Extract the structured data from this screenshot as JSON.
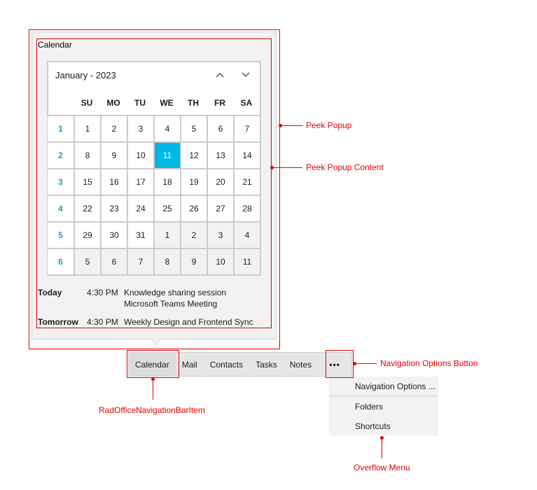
{
  "popup": {
    "title": "Calendar",
    "calendar": {
      "month_label": "January - 2023",
      "prev_icon": "chevron-up-icon",
      "next_icon": "chevron-down-icon",
      "prev_glyph": "⌃",
      "next_glyph": "⌄",
      "days_of_week": [
        "SU",
        "MO",
        "TU",
        "WE",
        "TH",
        "FR",
        "SA"
      ],
      "selected_date": "11",
      "accent_color": "#00b8e6",
      "week_number_color": "#1a9fc0",
      "weeks": [
        {
          "week": "1",
          "days": [
            {
              "d": "1"
            },
            {
              "d": "2"
            },
            {
              "d": "3"
            },
            {
              "d": "4"
            },
            {
              "d": "5"
            },
            {
              "d": "6"
            },
            {
              "d": "7"
            }
          ]
        },
        {
          "week": "2",
          "days": [
            {
              "d": "8"
            },
            {
              "d": "9"
            },
            {
              "d": "10"
            },
            {
              "d": "11",
              "selected": true
            },
            {
              "d": "12"
            },
            {
              "d": "13"
            },
            {
              "d": "14"
            }
          ]
        },
        {
          "week": "3",
          "days": [
            {
              "d": "15"
            },
            {
              "d": "16"
            },
            {
              "d": "17"
            },
            {
              "d": "18"
            },
            {
              "d": "19"
            },
            {
              "d": "20"
            },
            {
              "d": "21"
            }
          ]
        },
        {
          "week": "4",
          "days": [
            {
              "d": "22"
            },
            {
              "d": "23"
            },
            {
              "d": "24"
            },
            {
              "d": "25"
            },
            {
              "d": "26"
            },
            {
              "d": "27"
            },
            {
              "d": "28"
            }
          ]
        },
        {
          "week": "5",
          "days": [
            {
              "d": "29"
            },
            {
              "d": "30"
            },
            {
              "d": "31"
            },
            {
              "d": "1",
              "other": true
            },
            {
              "d": "2",
              "other": true
            },
            {
              "d": "3",
              "other": true
            },
            {
              "d": "4",
              "other": true
            }
          ]
        },
        {
          "week": "6",
          "days": [
            {
              "d": "5",
              "other": true
            },
            {
              "d": "6",
              "other": true
            },
            {
              "d": "7",
              "other": true
            },
            {
              "d": "8",
              "other": true
            },
            {
              "d": "9",
              "other": true
            },
            {
              "d": "10",
              "other": true
            },
            {
              "d": "11",
              "other": true
            }
          ]
        }
      ]
    },
    "agenda": [
      {
        "day": "Today",
        "time": "4:30 PM",
        "title": "Knowledge sharing session",
        "subtitle": "Microsoft Teams Meeting"
      },
      {
        "day": "Tomorrow",
        "time": "4:30 PM",
        "title": "Weekly Design and Frontend Sync"
      }
    ]
  },
  "navbar": {
    "items": [
      {
        "label": "Calendar",
        "active": true
      },
      {
        "label": "Mail"
      },
      {
        "label": "Contacts"
      },
      {
        "label": "Tasks"
      },
      {
        "label": "Notes"
      }
    ],
    "more_button": {
      "label": "•••",
      "icon": "ellipsis-icon"
    }
  },
  "overflow_menu": {
    "items": [
      "Navigation Options ...",
      "Folders",
      "Shortcuts"
    ]
  },
  "annotations": {
    "color": "#e00000",
    "peek_popup": "Peek Popup",
    "peek_popup_content": "Peek Popup Content",
    "nav_options_button": "Navigation Options Button",
    "nav_bar_item": "RadOfficeNavigationBarItem",
    "overflow_menu": "Overflow Menu"
  }
}
